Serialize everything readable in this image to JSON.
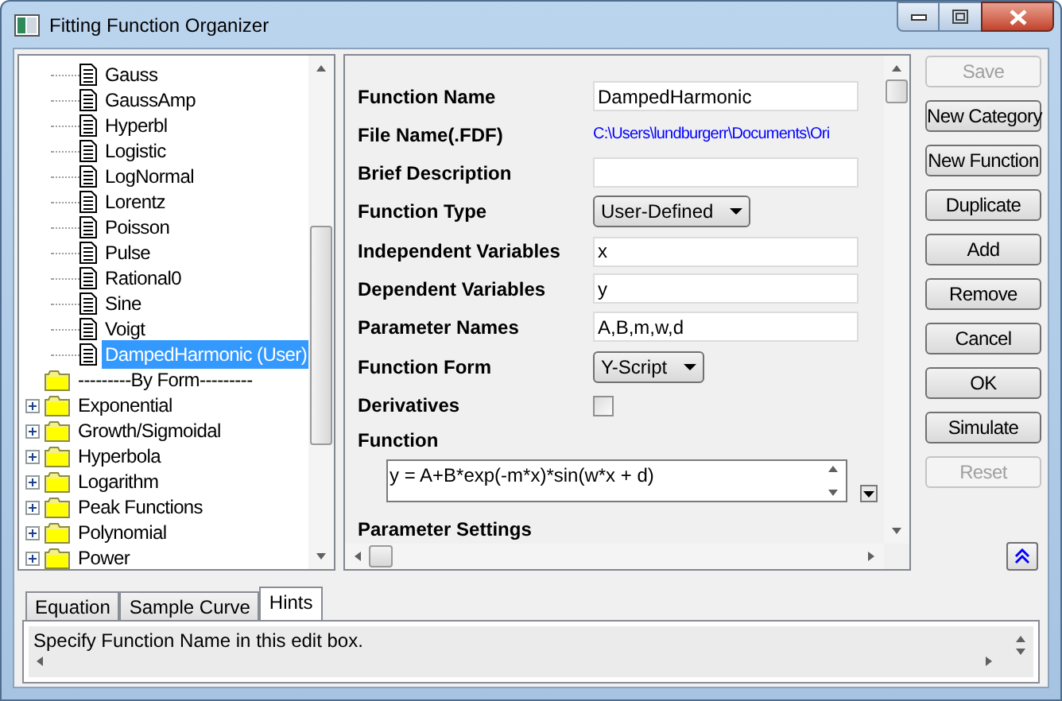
{
  "window": {
    "title": "Fitting Function Organizer"
  },
  "tree": {
    "items": [
      {
        "kind": "file",
        "label": "Gauss",
        "selected": false
      },
      {
        "kind": "file",
        "label": "GaussAmp",
        "selected": false
      },
      {
        "kind": "file",
        "label": "Hyperbl",
        "selected": false
      },
      {
        "kind": "file",
        "label": "Logistic",
        "selected": false
      },
      {
        "kind": "file",
        "label": "LogNormal",
        "selected": false
      },
      {
        "kind": "file",
        "label": "Lorentz",
        "selected": false
      },
      {
        "kind": "file",
        "label": "Poisson",
        "selected": false
      },
      {
        "kind": "file",
        "label": "Pulse",
        "selected": false
      },
      {
        "kind": "file",
        "label": "Rational0",
        "selected": false
      },
      {
        "kind": "file",
        "label": "Sine",
        "selected": false
      },
      {
        "kind": "file",
        "label": "Voigt",
        "selected": false
      },
      {
        "kind": "file",
        "label": "DampedHarmonic (User)",
        "selected": true
      },
      {
        "kind": "header",
        "label": "---------By Form---------",
        "selected": false
      },
      {
        "kind": "folder",
        "label": "Exponential",
        "selected": false,
        "expanded": false
      },
      {
        "kind": "folder",
        "label": "Growth/Sigmoidal",
        "selected": false,
        "expanded": false
      },
      {
        "kind": "folder",
        "label": "Hyperbola",
        "selected": false,
        "expanded": false
      },
      {
        "kind": "folder",
        "label": "Logarithm",
        "selected": false,
        "expanded": false
      },
      {
        "kind": "folder",
        "label": "Peak Functions",
        "selected": false,
        "expanded": false
      },
      {
        "kind": "folder",
        "label": "Polynomial",
        "selected": false,
        "expanded": false
      },
      {
        "kind": "folder",
        "label": "Power",
        "selected": false,
        "expanded": false
      }
    ]
  },
  "form": {
    "rows": [
      {
        "kind": "text",
        "label": "Function Name",
        "value": "DampedHarmonic"
      },
      {
        "kind": "link",
        "label": "File Name(.FDF)",
        "value": "C:\\Users\\lundburgerr\\Documents\\Ori"
      },
      {
        "kind": "text",
        "label": "Brief Description"
      },
      {
        "kind": "combo",
        "label": "Function Type",
        "value": "User-Defined"
      },
      {
        "kind": "text",
        "label": "Independent Variables",
        "value": "x"
      },
      {
        "kind": "text",
        "label": "Dependent Variables",
        "value": "y"
      },
      {
        "kind": "text",
        "label": "Parameter Names",
        "value": "A,B,m,w,d"
      },
      {
        "kind": "combo",
        "label": "Function Form",
        "value": "Y-Script"
      },
      {
        "kind": "checkbox",
        "label": "Derivatives",
        "checked": false
      },
      {
        "kind": "code",
        "label": "Function",
        "value": "y = A+B*exp(-m*x)*sin(w*x + d)"
      },
      {
        "kind": "heading",
        "label": "Parameter Settings"
      }
    ]
  },
  "buttons": [
    {
      "label": "Save",
      "disabled": true
    },
    {
      "label": "New Category",
      "disabled": false
    },
    {
      "label": "New Function",
      "disabled": false
    },
    {
      "label": "Duplicate",
      "disabled": false
    },
    {
      "label": "Add",
      "disabled": false
    },
    {
      "label": "Remove",
      "disabled": false
    },
    {
      "label": "Cancel",
      "disabled": false
    },
    {
      "label": "OK",
      "disabled": false
    },
    {
      "label": "Simulate",
      "disabled": false
    },
    {
      "label": "Reset",
      "disabled": true
    }
  ],
  "tabs": [
    {
      "label": "Equation",
      "selected": false
    },
    {
      "label": "Sample Curve",
      "selected": false
    },
    {
      "label": "Hints",
      "selected": true
    }
  ],
  "hint": {
    "text": "Specify Function Name in this edit box."
  }
}
